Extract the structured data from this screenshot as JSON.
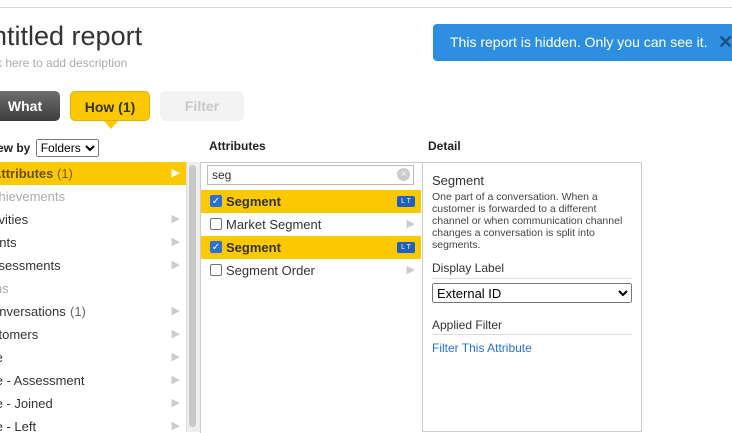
{
  "report": {
    "title": "ntitled report",
    "description": "k here to add description"
  },
  "banner": {
    "message": "This report is hidden. Only you can see it.",
    "close_glyph": "✕"
  },
  "toolbar": {
    "what_label": "What",
    "how_label": "How (1)",
    "filter_label": "Filter"
  },
  "viewby": {
    "label": "ew by",
    "selected": "Folders"
  },
  "columns": {
    "attributes_header": "Attributes",
    "detail_header": "Detail"
  },
  "folders": [
    {
      "label": "Attributes",
      "count": "(1)",
      "selected": true,
      "muted": false,
      "arrow": "▶"
    },
    {
      "label": "chievements",
      "count": "",
      "selected": false,
      "muted": true,
      "arrow": ""
    },
    {
      "label": "tivities",
      "count": "",
      "selected": false,
      "muted": false,
      "arrow": "▶"
    },
    {
      "label": "ents",
      "count": "",
      "selected": false,
      "muted": false,
      "arrow": "▶"
    },
    {
      "label": "ssessments",
      "count": "",
      "selected": false,
      "muted": false,
      "arrow": "▶"
    },
    {
      "label": "ins",
      "count": "",
      "selected": false,
      "muted": true,
      "arrow": ""
    },
    {
      "label": "onversations",
      "count": "(1)",
      "selected": false,
      "muted": false,
      "arrow": "▶"
    },
    {
      "label": "stomers",
      "count": "",
      "selected": false,
      "muted": false,
      "arrow": "▶"
    },
    {
      "label": "te",
      "count": "",
      "selected": false,
      "muted": false,
      "arrow": "▶"
    },
    {
      "label": "te - Assessment",
      "count": "",
      "selected": false,
      "muted": false,
      "arrow": "▶"
    },
    {
      "label": "te - Joined",
      "count": "",
      "selected": false,
      "muted": false,
      "arrow": "▶"
    },
    {
      "label": "te - Left",
      "count": "",
      "selected": false,
      "muted": false,
      "arrow": "▶"
    }
  ],
  "attributes": {
    "search_value": "seg",
    "clear_glyph": "×",
    "items": [
      {
        "label": "Segment",
        "checked": true,
        "selected": true,
        "tag": "L T",
        "arrow": ""
      },
      {
        "label": "Market Segment",
        "checked": false,
        "selected": false,
        "tag": "",
        "arrow": "▶"
      },
      {
        "label": "Segment",
        "checked": true,
        "selected": true,
        "tag": "L T",
        "arrow": ""
      },
      {
        "label": "Segment Order",
        "checked": false,
        "selected": false,
        "tag": "",
        "arrow": "▶"
      }
    ]
  },
  "detail": {
    "name": "Segment",
    "description": "One part of a conversation. When a customer is forwarded to a different channel or when communication channel changes a conversation is split into segments.",
    "display_label_heading": "Display Label",
    "display_label_value": "External ID",
    "applied_filter_heading": "Applied Filter",
    "filter_link": "Filter This Attribute"
  },
  "colors": {
    "accent": "#fcc800",
    "banner": "#2e8fe0",
    "link": "#2a6fd6"
  }
}
